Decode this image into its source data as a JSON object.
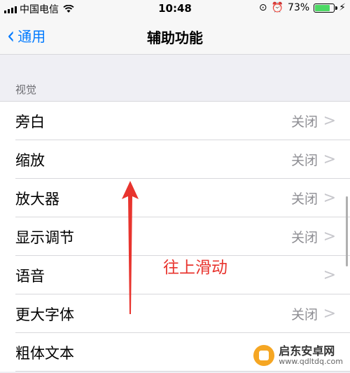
{
  "status_bar": {
    "carrier": "中国电信",
    "time": "10:48",
    "battery": "73%",
    "battery_level": 0.73
  },
  "nav": {
    "back_label": "通用",
    "title": "辅助功能"
  },
  "section": {
    "header": "视觉"
  },
  "rows": [
    {
      "label": "旁白",
      "value": "关闭"
    },
    {
      "label": "缩放",
      "value": "关闭"
    },
    {
      "label": "放大器",
      "value": "关闭"
    },
    {
      "label": "显示调节",
      "value": "关闭"
    },
    {
      "label": "语音",
      "value": ""
    },
    {
      "label": "更大字体",
      "value": "关闭"
    },
    {
      "label": "粗体文本",
      "value": ""
    }
  ],
  "annotation": {
    "text": "往上滑动",
    "color": "#e8342e"
  },
  "watermark": {
    "name": "启东安卓网",
    "url": "www.qdltdq.com"
  },
  "colors": {
    "accent": "#007aff",
    "background": "#efeff4"
  }
}
